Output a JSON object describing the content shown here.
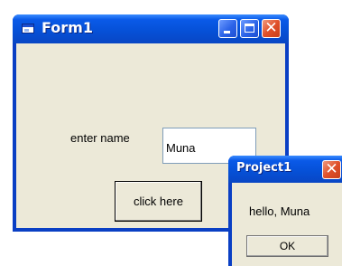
{
  "form": {
    "title": "Form1",
    "label": "enter name",
    "input_value": "Muna",
    "button_label": "click here"
  },
  "msgbox": {
    "title": "Project1",
    "message": "hello, Muna",
    "ok_label": "OK"
  },
  "icons": {
    "app": "form-app-icon",
    "minimize": "minimize-icon",
    "maximize": "maximize-icon",
    "close": "close-icon"
  },
  "colors": {
    "titlebar": "#0651d8",
    "close_button": "#e0502a",
    "window_face": "#ece9d8"
  }
}
